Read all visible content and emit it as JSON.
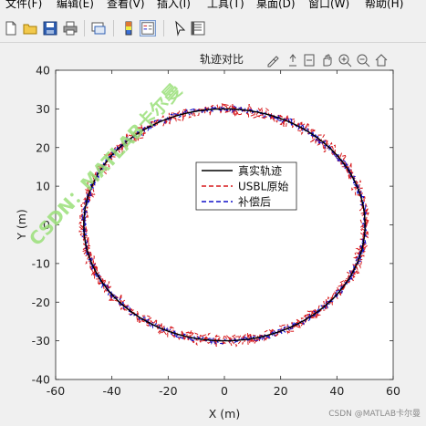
{
  "menu": [
    "文件(F)",
    "编辑(E)",
    "查看(V)",
    "插入(I)",
    "工具(T)",
    "桌面(D)",
    "窗口(W)",
    "帮助(H)"
  ],
  "toolbar_icons": [
    "new-file-icon",
    "open-folder-icon",
    "save-icon",
    "print-icon",
    "link-plot-icon",
    "colorbar-icon",
    "legend-icon",
    "pointer-icon",
    "property-inspector-icon"
  ],
  "axes_toolbar_icons": [
    "brush-icon",
    "data-tips-icon",
    "rotate-icon",
    "pan-icon",
    "zoom-in-icon",
    "zoom-out-icon",
    "home-icon"
  ],
  "watermark": "CSDN：MATLAB卡尔曼",
  "credit": "CSDN @MATLAB卡尔曼",
  "chart_data": {
    "type": "line",
    "title": "轨迹对比",
    "xlabel": "X (m)",
    "ylabel": "Y (m)",
    "xlim": [
      -60,
      60
    ],
    "ylim": [
      -40,
      40
    ],
    "xticks": [
      -60,
      -40,
      -20,
      0,
      20,
      40,
      60
    ],
    "yticks": [
      -40,
      -30,
      -20,
      -10,
      0,
      10,
      20,
      30,
      40
    ],
    "legend_position": "center",
    "series": [
      {
        "name": "真实轨迹",
        "color": "#000000",
        "style": "solid",
        "shape": "ellipse",
        "center": [
          0,
          0
        ],
        "radius_x": 50,
        "radius_y": 30,
        "noise": 0
      },
      {
        "name": "USBL原始",
        "color": "#d7191c",
        "style": "dashed",
        "shape": "ellipse",
        "center": [
          0,
          0
        ],
        "radius_x": 50,
        "radius_y": 30,
        "noise": 1.6
      },
      {
        "name": "补偿后",
        "color": "#1010c8",
        "style": "dashed",
        "shape": "ellipse",
        "center": [
          0,
          0
        ],
        "radius_x": 50,
        "radius_y": 30,
        "noise": 0.8
      }
    ]
  }
}
